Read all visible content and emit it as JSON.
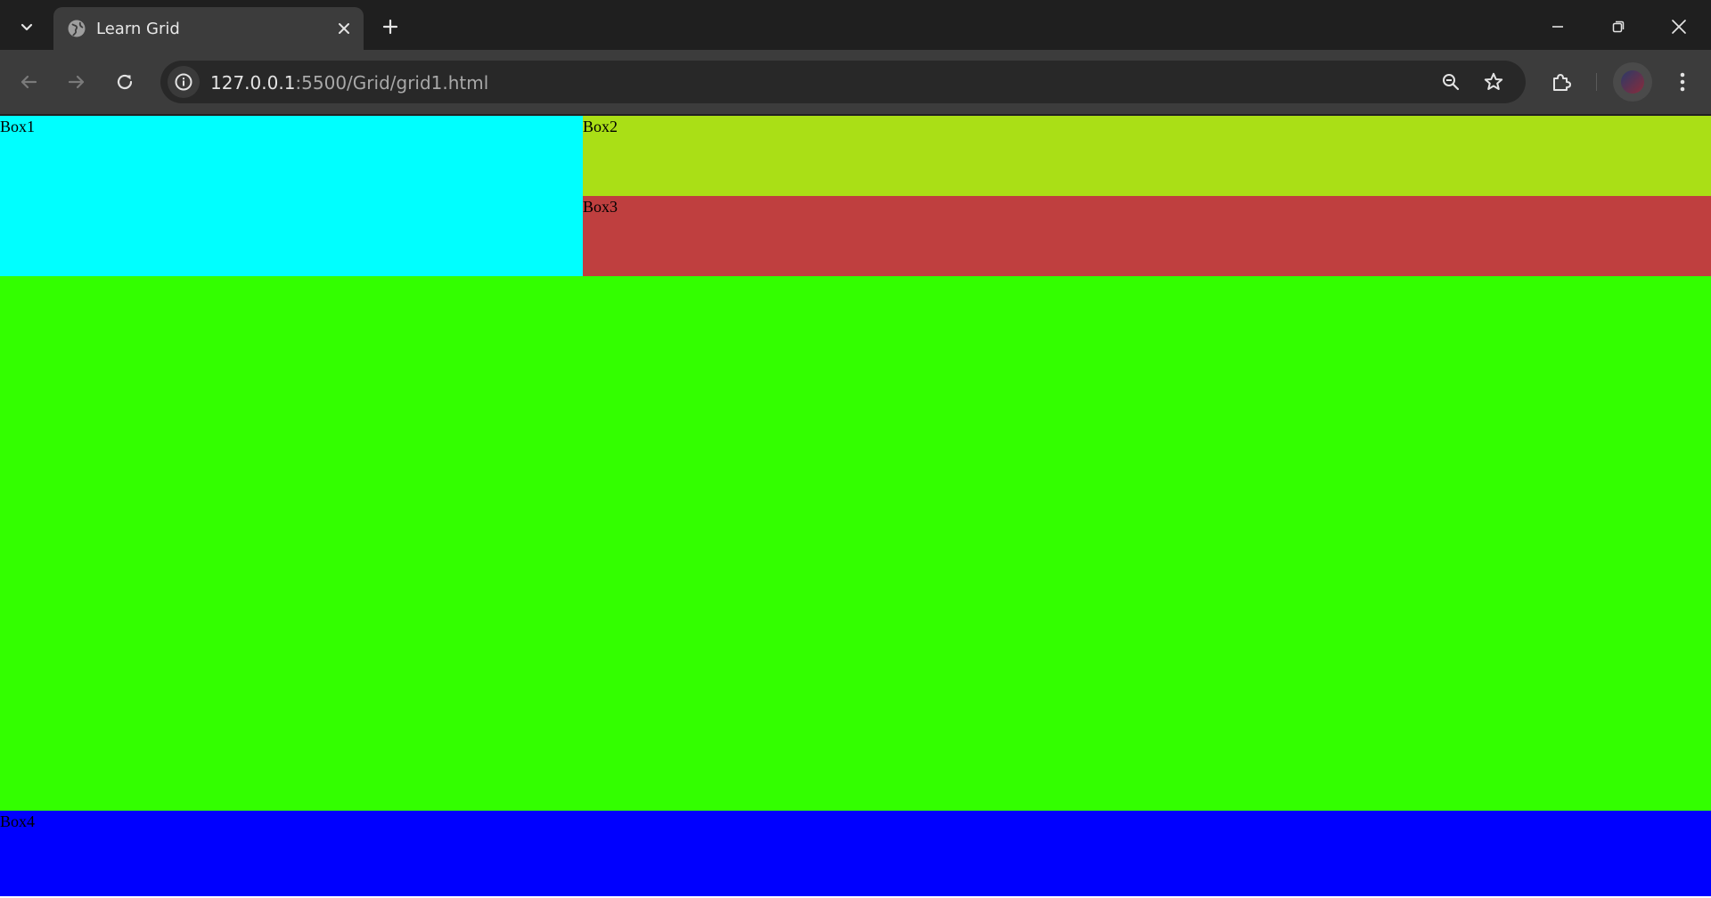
{
  "browser": {
    "tab": {
      "title": "Learn Grid"
    },
    "address": {
      "host": "127.0.0.1",
      "path": ":5500/Grid/grid1.html"
    }
  },
  "page": {
    "boxes": [
      {
        "label": "Box1",
        "color": "#00ffff"
      },
      {
        "label": "Box2",
        "color": "#aadf16"
      },
      {
        "label": "Box3",
        "color": "#bf3f3f"
      },
      {
        "label": "",
        "color": "#33ff00"
      },
      {
        "label": "Box4",
        "color": "#0000ff"
      }
    ]
  },
  "icons": {
    "tab_search": "chevron-down-icon",
    "favicon": "globe-icon",
    "tab_close": "close-icon",
    "new_tab": "plus-icon",
    "back": "arrow-left-icon",
    "forward": "arrow-right-icon",
    "reload": "reload-icon",
    "site_info": "info-icon",
    "zoom": "zoom-out-icon",
    "bookmark": "star-icon",
    "extensions": "puzzle-icon",
    "menu": "kebab-menu-icon",
    "minimize": "minimize-icon",
    "restore": "restore-icon",
    "close_window": "close-window-icon"
  }
}
